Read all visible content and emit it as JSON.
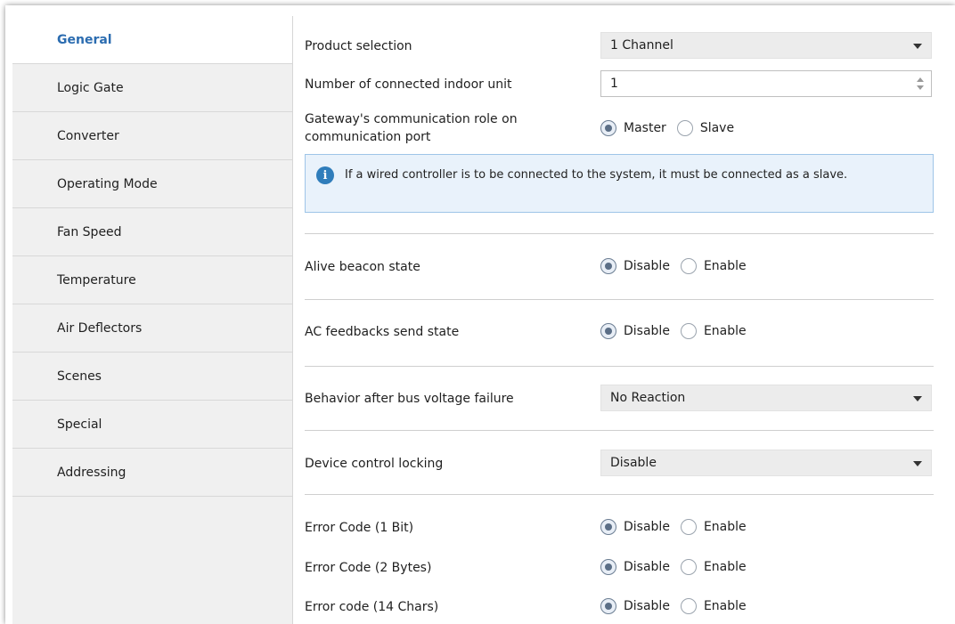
{
  "sidebar": {
    "items": [
      {
        "label": "General"
      },
      {
        "label": "Logic Gate"
      },
      {
        "label": "Converter"
      },
      {
        "label": "Operating Mode"
      },
      {
        "label": "Fan Speed"
      },
      {
        "label": "Temperature"
      },
      {
        "label": "Air Deflectors"
      },
      {
        "label": "Scenes"
      },
      {
        "label": "Special"
      },
      {
        "label": "Addressing"
      }
    ],
    "active": "General"
  },
  "main": {
    "product_selection": {
      "label": "Product selection",
      "value": "1 Channel"
    },
    "indoor_units": {
      "label": "Number of connected indoor unit",
      "value": "1"
    },
    "comm_role": {
      "label_line1": "Gateway's communication role on",
      "label_line2": "communication port",
      "options": [
        "Master",
        "Slave"
      ],
      "selected": "Master"
    },
    "info": {
      "text": "If a wired controller is to be connected to the system, it must be connected as a slave."
    },
    "alive_beacon": {
      "label": "Alive beacon state",
      "options": [
        "Disable",
        "Enable"
      ],
      "selected": "Disable"
    },
    "ac_feedbacks": {
      "label": "AC feedbacks send state",
      "options": [
        "Disable",
        "Enable"
      ],
      "selected": "Disable"
    },
    "bus_failure": {
      "label": "Behavior after bus voltage failure",
      "value": "No Reaction"
    },
    "control_locking": {
      "label": "Device control locking",
      "value": "Disable"
    },
    "error_1bit": {
      "label": "Error Code (1 Bit)",
      "options": [
        "Disable",
        "Enable"
      ],
      "selected": "Disable"
    },
    "error_2bytes": {
      "label": "Error Code (2 Bytes)",
      "options": [
        "Disable",
        "Enable"
      ],
      "selected": "Disable"
    },
    "error_14chars": {
      "label": "Error code (14 Chars)",
      "options": [
        "Disable",
        "Enable"
      ],
      "selected": "Disable"
    }
  },
  "colors": {
    "accent": "#2b6cb0",
    "sidebar_bg": "#f0f0f0",
    "info_bg": "#e9f2fb",
    "info_icon": "#2f7dbb"
  }
}
